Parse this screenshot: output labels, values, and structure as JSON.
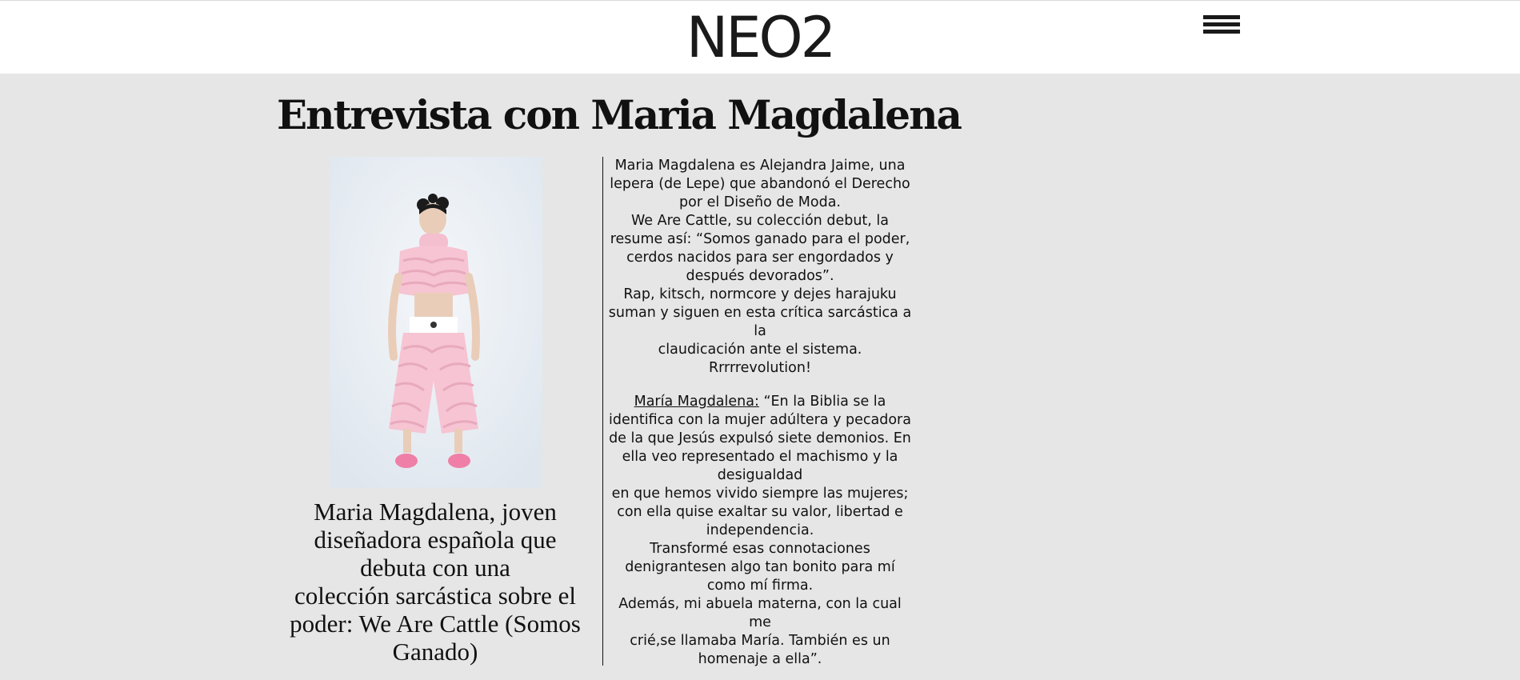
{
  "header": {
    "logo_text": "NEO2",
    "menu_icon": "hamburger-menu-icon"
  },
  "article": {
    "title": "Entrevista con Maria Magdalena",
    "caption_lines": [
      "Maria Magdalena, joven",
      "diseñadora española que",
      "debuta con una",
      "colección sarcástica sobre el",
      "poder: We Are Cattle (Somos",
      "Ganado)"
    ],
    "intro_lines": [
      "Maria Magdalena es Alejandra Jaime, una",
      "lepera (de Lepe) que abandonó el Derecho",
      "por el Diseño de Moda.",
      "We Are Cattle, su colección debut, la",
      "resume así: “Somos ganado para el poder,",
      "cerdos nacidos para ser engordados y",
      "después devorados”.",
      "Rap, kitsch, normcore y dejes harajuku",
      "suman y siguen en esta crítica sarcástica a la",
      "claudicación ante el sistema. Rrrrrevolution!"
    ],
    "speaker": "María Magdalena:",
    "quote_first": " “En la Biblia se la",
    "quote_lines": [
      "identifica con la mujer adúltera y pecadora",
      "de la que Jesús expulsó siete demonios. En",
      "ella veo representado el machismo y la",
      "desigualdad",
      "en que hemos vivido siempre las mujeres;",
      "con ella quise exaltar su valor, libertad e",
      "independencia.",
      "Transformé esas connotaciones",
      "denigrantesen algo tan bonito para mí",
      "como mí firma.",
      "Además, mi abuela materna, con la cual me",
      "crié,se llamaba María. También es un",
      "homenaje a ella”."
    ]
  },
  "colors": {
    "background": "#e6e6e6",
    "header_background": "#ffffff",
    "text": "#111111",
    "outfit_pink": "#f6c4d2"
  }
}
